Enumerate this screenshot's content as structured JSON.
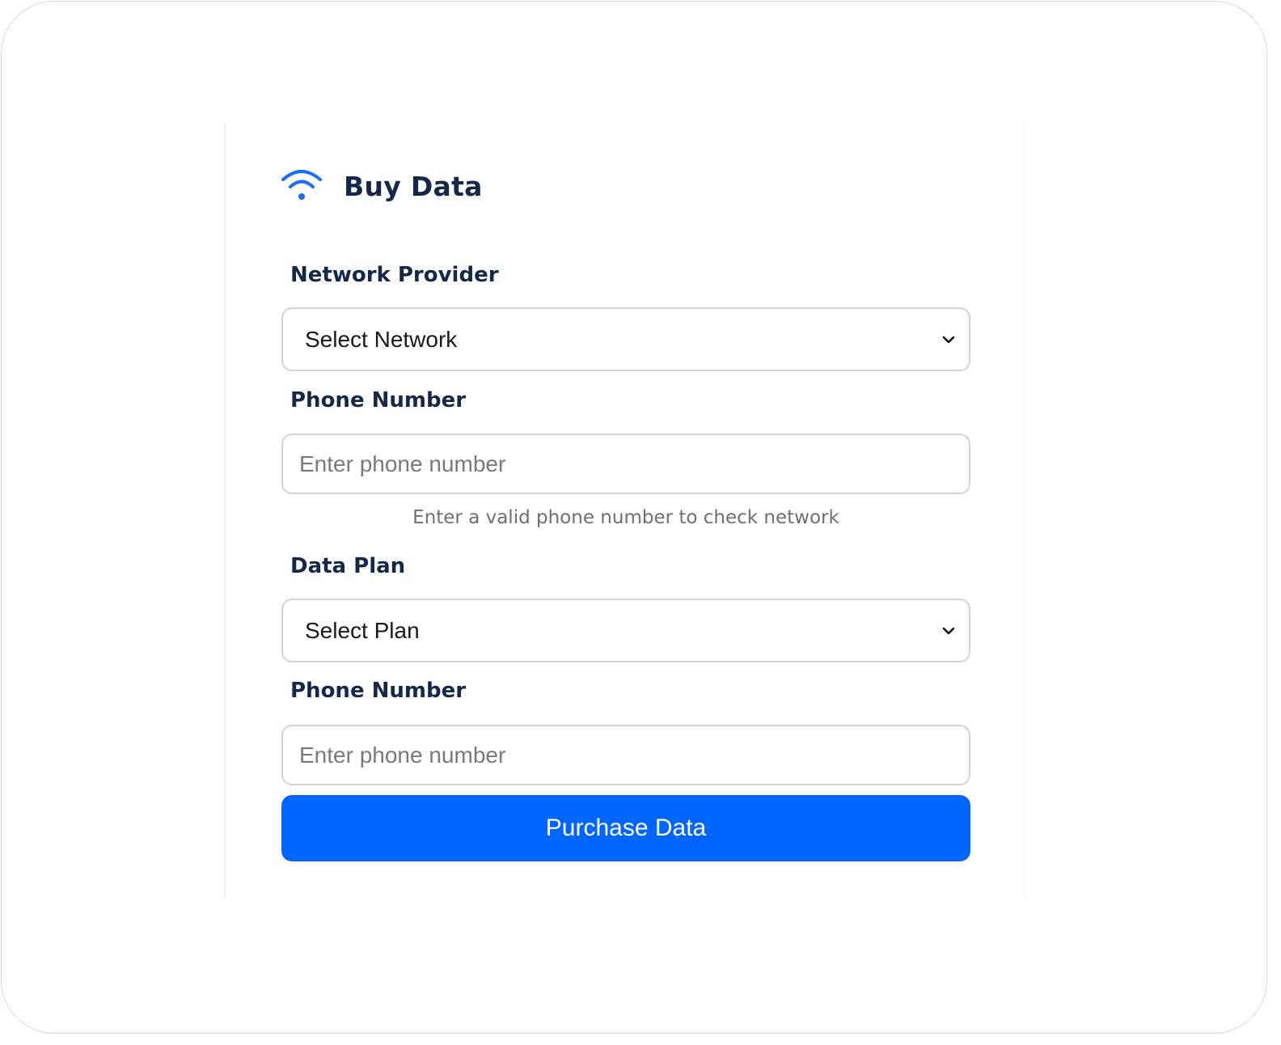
{
  "page": {
    "title": "Buy Data",
    "title_icon": "wifi-icon",
    "accent_color": "#0066ff",
    "heading_color": "#14294a"
  },
  "form": {
    "network": {
      "label": "Network Provider",
      "selected": "Select Network",
      "icon": "chevron-down-icon"
    },
    "phone1": {
      "label": "Phone Number",
      "placeholder": "Enter phone number",
      "value": ""
    },
    "hint": "Enter a valid phone number to check network",
    "plan": {
      "label": "Data Plan",
      "selected": "Select Plan",
      "icon": "chevron-down-icon"
    },
    "phone2": {
      "label": "Phone Number",
      "placeholder": "Enter phone number",
      "value": ""
    },
    "submit_label": "Purchase Data"
  }
}
